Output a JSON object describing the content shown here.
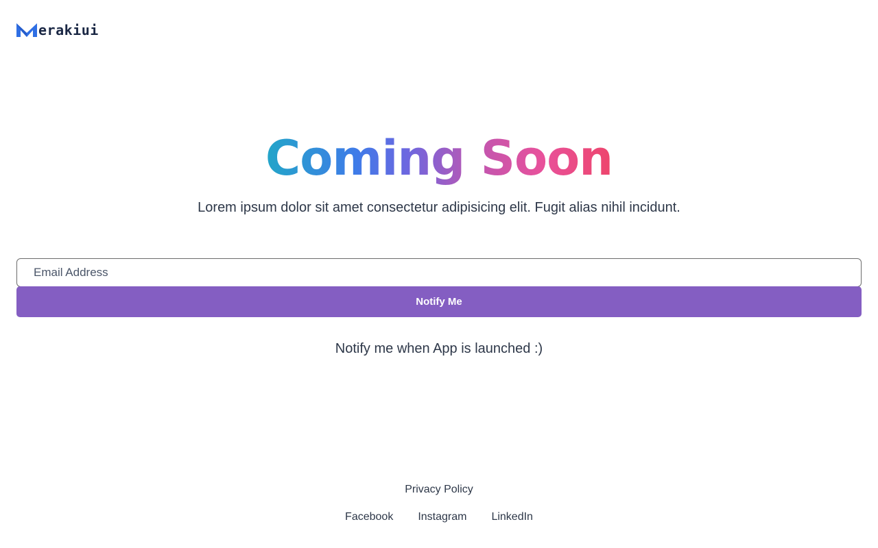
{
  "header": {
    "logo_text": "erakiui",
    "logo_icon": "m-logo-icon",
    "brand_color": "#2f6fe4"
  },
  "hero": {
    "title": "Coming Soon",
    "subtitle": "Lorem ipsum dolor sit amet consectetur adipisicing elit. Fugit alias nihil incidunt."
  },
  "form": {
    "email_placeholder": "Email Address",
    "email_value": "",
    "button_label": "Notify Me",
    "button_color": "#845ec2",
    "note": "Notify me when App is launched :)"
  },
  "footer": {
    "privacy": "Privacy Policy",
    "social": [
      "Facebook",
      "Instagram",
      "LinkedIn"
    ]
  }
}
